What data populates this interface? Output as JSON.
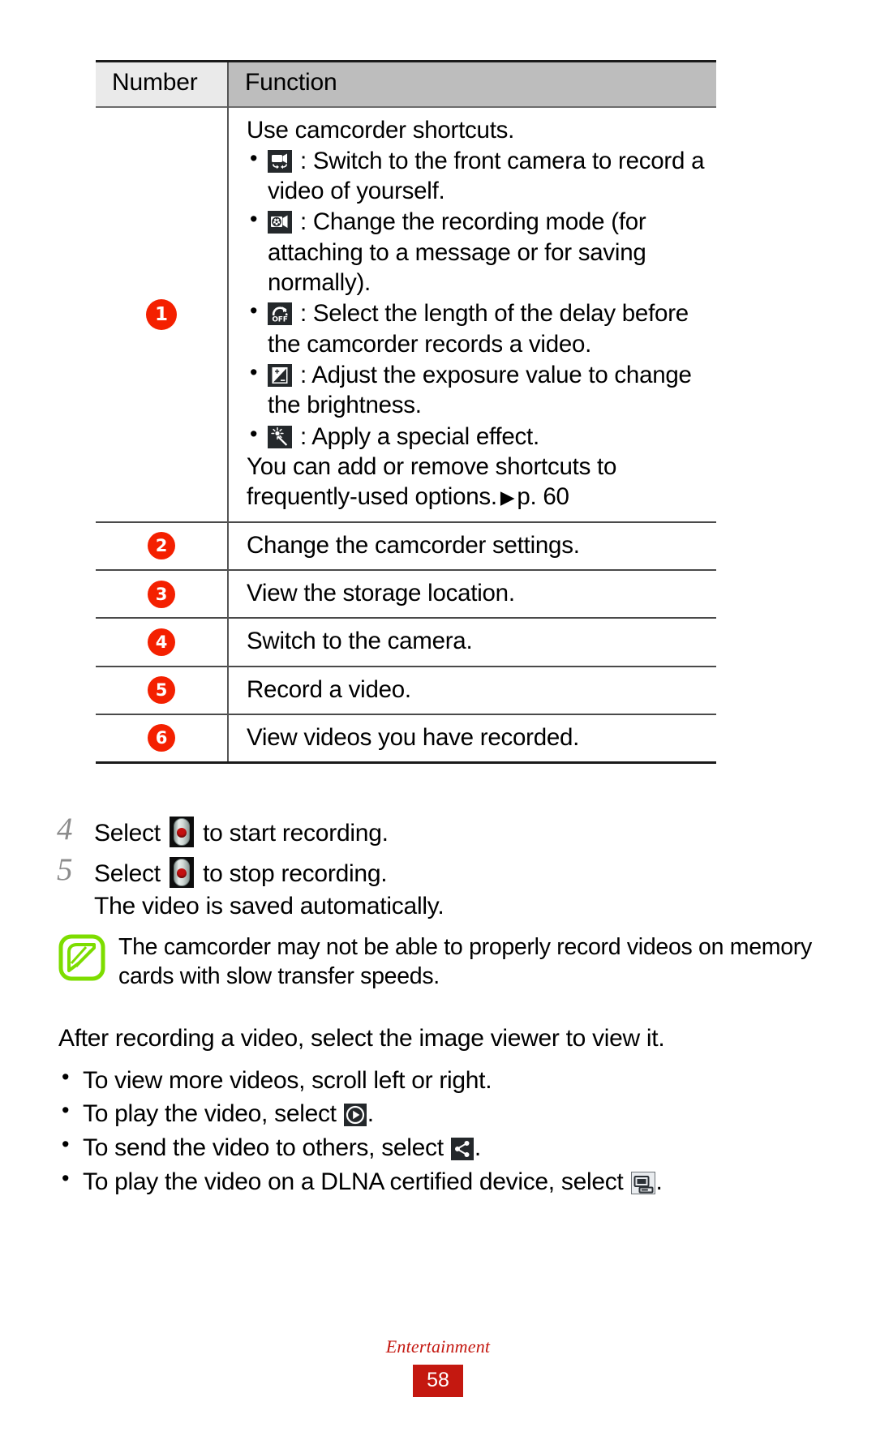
{
  "table": {
    "headers": {
      "number": "Number",
      "function": "Function"
    },
    "rows": [
      {
        "number": "1",
        "intro": "Use camcorder shortcuts.",
        "bullets": [
          {
            "icon": "switch-front-camera-icon",
            "text": ": Switch to the front camera to record a video of yourself."
          },
          {
            "icon": "recording-mode-icon",
            "text": ": Change the recording mode (for attaching to a message or for saving normally)."
          },
          {
            "icon": "timer-off-icon",
            "text": ": Select the length of the delay before the camcorder records a video."
          },
          {
            "icon": "exposure-value-icon",
            "text": ": Adjust the exposure value to change the brightness."
          },
          {
            "icon": "special-effect-icon",
            "text": ": Apply a special effect."
          }
        ],
        "outro_line1": "You can add or remove shortcuts to",
        "outro_line2": "frequently-used options.",
        "page_ref": "p. 60"
      },
      {
        "number": "2",
        "text": "Change the camcorder settings."
      },
      {
        "number": "3",
        "text": "View the storage location."
      },
      {
        "number": "4",
        "text": "Switch to the camera."
      },
      {
        "number": "5",
        "text": "Record a video."
      },
      {
        "number": "6",
        "text": "View videos you have recorded."
      }
    ]
  },
  "steps": [
    {
      "num": "4",
      "before": "Select",
      "icon": "record-button-icon",
      "after": "to start recording."
    },
    {
      "num": "5",
      "before": "Select",
      "icon": "record-button-icon",
      "after": "to stop recording."
    }
  ],
  "step_substep": "The video is saved automatically.",
  "note": {
    "icon": "note-pen-icon",
    "text": "The camcorder may not be able to properly record videos on memory cards with slow transfer speeds."
  },
  "tail": {
    "lead": "After recording a video, select the image viewer to view it.",
    "bullets": [
      {
        "before": "To view more videos, scroll left or right.",
        "icon": null,
        "after": ""
      },
      {
        "before": "To play the video, select",
        "icon": "play-icon",
        "after": "."
      },
      {
        "before": "To send the video to others, select",
        "icon": "share-icon",
        "after": "."
      },
      {
        "before": "To play the video on a DLNA certified device, select",
        "icon": "dlna-icon",
        "after": "."
      }
    ]
  },
  "footer": {
    "section": "Entertainment",
    "page": "58"
  },
  "colors": {
    "accent_red": "#c41810",
    "circle_red": "#f42000",
    "note_green": "#7ddd00",
    "header_gray": "#bdbdbd"
  }
}
